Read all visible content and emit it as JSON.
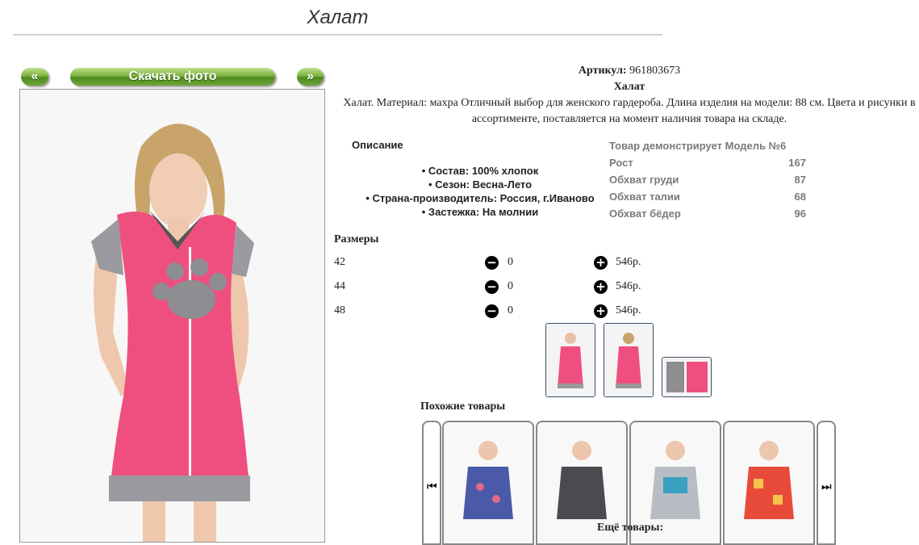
{
  "page": {
    "title": "Халат"
  },
  "gallery": {
    "prev": "«",
    "download": "Скачать фото",
    "next": "»"
  },
  "product": {
    "sku_label": "Артикул:",
    "sku": "961803673",
    "name": "Халат",
    "description": "Халат. Материал: махра Отличный выбор для женского гардероба. Длина изделия на модели: 88 см. Цвета и рисунки в ассортименте, поставляется на момент наличия товара на складе."
  },
  "features": {
    "title": "Описание",
    "items": [
      "Состав: 100% хлопок",
      "Сезон: Весна-Лето",
      "Страна-производитель: Россия, г.Иваново",
      "Застежка: На молнии"
    ]
  },
  "model": {
    "title": "Товар демонстрирует Модель №6",
    "rows": [
      {
        "label": "Рост",
        "value": "167"
      },
      {
        "label": "Обхват груди",
        "value": "87"
      },
      {
        "label": "Обхват талии",
        "value": "68"
      },
      {
        "label": "Обхват бёдер",
        "value": "96"
      }
    ]
  },
  "sizes": {
    "title": "Размеры",
    "rows": [
      {
        "size": "42",
        "qty": "0",
        "price": "546р."
      },
      {
        "size": "44",
        "qty": "0",
        "price": "546р."
      },
      {
        "size": "48",
        "qty": "0",
        "price": "546р."
      }
    ]
  },
  "similar": {
    "title": "Похожие товары"
  },
  "more": {
    "label": "Ещё товары:"
  },
  "colors": {
    "dress_pink": "#ef4f7f",
    "accent_green": "#5f9a2a",
    "thumb_border": "#3a5068"
  }
}
